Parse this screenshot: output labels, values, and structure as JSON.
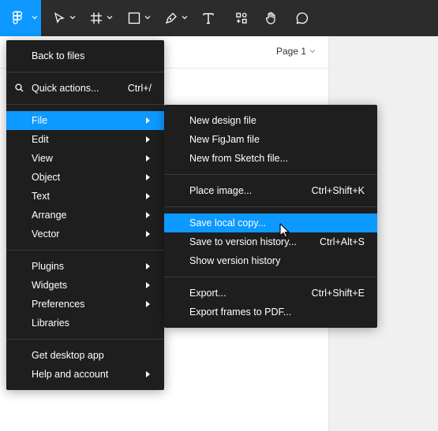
{
  "page_selector": {
    "label": "Page 1"
  },
  "main_menu": {
    "back": "Back to files",
    "quick_actions": {
      "label": "Quick actions...",
      "shortcut": "Ctrl+/"
    },
    "file": "File",
    "edit": "Edit",
    "view": "View",
    "object": "Object",
    "text": "Text",
    "arrange": "Arrange",
    "vector": "Vector",
    "plugins": "Plugins",
    "widgets": "Widgets",
    "preferences": "Preferences",
    "libraries": "Libraries",
    "desktop_app": "Get desktop app",
    "help": "Help and account"
  },
  "file_menu": {
    "new_design": "New design file",
    "new_figjam": "New FigJam file",
    "new_sketch": "New from Sketch file...",
    "place_image": {
      "label": "Place image...",
      "shortcut": "Ctrl+Shift+K"
    },
    "save_local": "Save local copy...",
    "save_version": {
      "label": "Save to version history...",
      "shortcut": "Ctrl+Alt+S"
    },
    "show_version": "Show version history",
    "export": {
      "label": "Export...",
      "shortcut": "Ctrl+Shift+E"
    },
    "export_pdf": "Export frames to PDF..."
  },
  "colors": {
    "accent": "#0d99ff",
    "toolbar": "#2c2c2c",
    "menu": "#1e1e1e"
  }
}
